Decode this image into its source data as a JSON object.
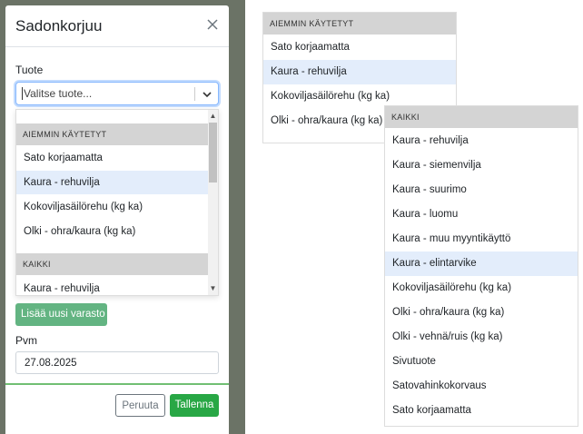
{
  "modal": {
    "title": "Sadonkorjuu",
    "product_label": "Tuote",
    "product_placeholder": "Valitse tuote...",
    "dropdown": {
      "recent_header": "AIEMMIN KÄYTETYT",
      "recent_items": [
        "Sato korjaamatta",
        "Kaura - rehuvilja",
        "Kokoviljasäilörehu (kg ka)",
        "Olki - ohra/kaura (kg ka)"
      ],
      "all_header": "KAIKKI",
      "all_items": [
        "Kaura - rehuvilja"
      ]
    },
    "add_storage_button": "Lisää uusi varasto",
    "date_label": "Pvm",
    "date_value": "27.08.2025",
    "cancel_button": "Peruuta",
    "save_button": "Tallenna"
  },
  "recent_panel": {
    "header": "AIEMMIN KÄYTETYT",
    "items": [
      "Sato korjaamatta",
      "Kaura - rehuvilja",
      "Kokoviljasäilörehu (kg ka)",
      "Olki - ohra/kaura (kg ka)"
    ],
    "selected": "Kaura - rehuvilja"
  },
  "all_panel": {
    "header": "KAIKKI",
    "items": [
      "Kaura - rehuvilja",
      "Kaura - siemenvilja",
      "Kaura - suurimo",
      "Kaura - luomu",
      "Kaura - muu myyntikäyttö",
      "Kaura - elintarvike",
      "Kokoviljasäilörehu (kg ka)",
      "Olki - ohra/kaura (kg ka)",
      "Olki - vehnä/ruis (kg ka)",
      "Sivutuote",
      "Satovahinkokorvaus",
      "Sato korjaamatta"
    ],
    "selected": "Kaura - elintarvike"
  },
  "colors": {
    "backdrop": "#6b7366",
    "selected_option": "#e3edfb",
    "group_header": "#d4d4d4",
    "save_button": "#28a745",
    "add_button": "#63b482"
  }
}
